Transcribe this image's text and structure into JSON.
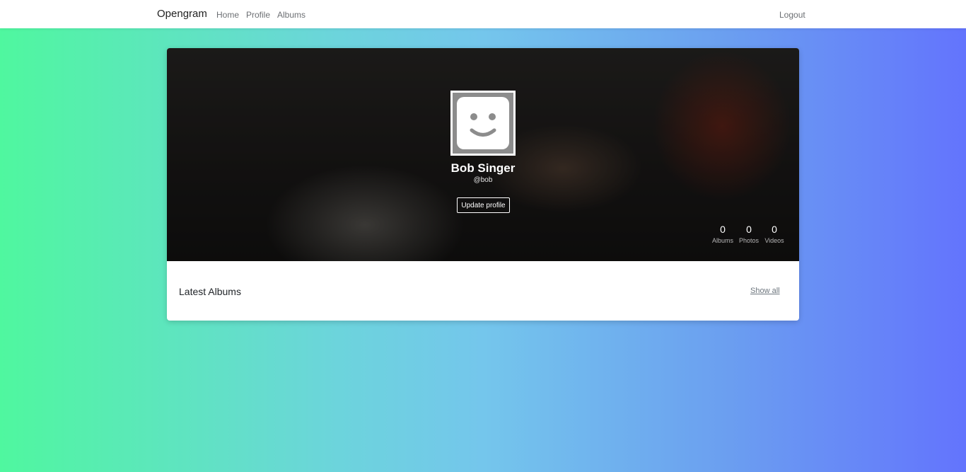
{
  "navbar": {
    "brand": "Opengram",
    "links": [
      {
        "label": "Home"
      },
      {
        "label": "Profile"
      },
      {
        "label": "Albums"
      }
    ],
    "logout": "Logout"
  },
  "profile": {
    "avatar_icon": "smiley-face-icon",
    "name": "Bob Singer",
    "handle": "@bob",
    "update_button": "Update profile",
    "stats": [
      {
        "value": "0",
        "label": "Albums"
      },
      {
        "value": "0",
        "label": "Photos"
      },
      {
        "value": "0",
        "label": "Videos"
      }
    ]
  },
  "latest": {
    "title": "Latest Albums",
    "show_all": "Show all"
  }
}
